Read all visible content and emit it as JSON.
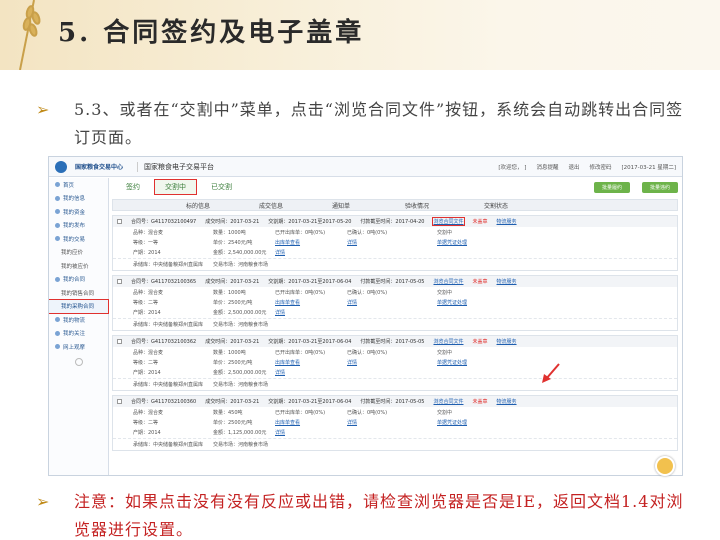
{
  "slide": {
    "title": "5. 合同签约及电子盖章",
    "bullet_symbol": "➢",
    "paragraph": "5.3、或者在“交割中”菜单，点击“浏览合同文件”按钮，系统会自动跳转出合同签订页面。",
    "note": "注意：如果点击没有没有反应或出错，请检查浏览器是否是IE，返回文档1.4对浏览器进行设置。"
  },
  "screenshot": {
    "logo_text": "国家粮食交易中心",
    "site_name": "国家粮食电子交易平台",
    "top_right": [
      "[欢迎您，        ]",
      "消息提醒",
      "退出",
      "修改密码",
      "[2017-03-21 星期二]"
    ],
    "sidebar": [
      {
        "label": "首页",
        "sub": false
      },
      {
        "label": "我的信息",
        "sub": false
      },
      {
        "label": "我的资金",
        "sub": false
      },
      {
        "label": "我的发布",
        "sub": false
      },
      {
        "label": "我的交易",
        "sub": false
      },
      {
        "label": "我的应价",
        "sub": true
      },
      {
        "label": "我的被应价",
        "sub": true
      },
      {
        "label": "我的合同",
        "sub": false
      },
      {
        "label": "我的销售合同",
        "sub": true
      },
      {
        "label": "我的采购合同",
        "sub": true,
        "active": true
      },
      {
        "label": "我的物流",
        "sub": false
      },
      {
        "label": "我的关注",
        "sub": false
      },
      {
        "label": "网上观摩",
        "sub": false
      }
    ],
    "tabs": [
      "签约",
      "交割中",
      "已交割"
    ],
    "tab_buttons": [
      "批量履约",
      "批量违约"
    ],
    "columns": [
      "标的信息",
      "成交信息",
      "通知单",
      "验收情况",
      "交割状态"
    ],
    "orders": [
      {
        "contract": "合同号：G4117032100497",
        "deal_time": "成交时间：2017-03-21",
        "delivery": "交割期：2017-03-21至2017-05-20",
        "pay_deadline": "付款截至时间：2017-04-20",
        "browse": "浏览合同文件",
        "status": "未盖章",
        "logistics": "物流服务",
        "variety": "品种：混合麦",
        "grade": "等级：一等",
        "year": "产期：2014",
        "qty": "数量：1000吨",
        "price": "单价：2540元/吨",
        "amount": "金额：2,540,000.00元",
        "out_ready": "已开出库单：0吨(0%)",
        "notice1": "出库单查看",
        "notice2": "详情",
        "accept": "已确认：0吨(0%)",
        "accept_detail": "详情",
        "state": "交割中",
        "view": "单据凭证处理",
        "repo": "承储库：中央储备粮郑州直属库",
        "market": "交易市场：河南粮食市场"
      },
      {
        "contract": "合同号：G4117032100365",
        "deal_time": "成交时间：2017-03-21",
        "delivery": "交割期：2017-03-21至2017-06-04",
        "pay_deadline": "付款截至时间：2017-05-05",
        "browse": "浏览合同文件",
        "status": "未盖章",
        "logistics": "物流服务",
        "variety": "品种：混合麦",
        "grade": "等级：二等",
        "year": "产期：2014",
        "qty": "数量：1000吨",
        "price": "单价：2500元/吨",
        "amount": "金额：2,500,000.00元",
        "out_ready": "已开出库单：0吨(0%)",
        "notice1": "出库单查看",
        "notice2": "详情",
        "accept": "已确认：0吨(0%)",
        "accept_detail": "详情",
        "state": "交割中",
        "view": "单据凭证处理",
        "repo": "承储库：中央储备粮郑州直属库",
        "market": "交易市场：河南粮食市场"
      },
      {
        "contract": "合同号：G4117032100362",
        "deal_time": "成交时间：2017-03-21",
        "delivery": "交割期：2017-03-21至2017-06-04",
        "pay_deadline": "付款截至时间：2017-05-05",
        "browse": "浏览合同文件",
        "status": "未盖章",
        "logistics": "物流服务",
        "variety": "品种：混合麦",
        "grade": "等级：二等",
        "year": "产期：2014",
        "qty": "数量：1000吨",
        "price": "单价：2500元/吨",
        "amount": "金额：2,500,000.00元",
        "out_ready": "已开出库单：0吨(0%)",
        "notice1": "出库单查看",
        "notice2": "详情",
        "accept": "已确认：0吨(0%)",
        "accept_detail": "详情",
        "state": "交割中",
        "view": "单据凭证处理",
        "repo": "承储库：中央储备粮郑州直属库",
        "market": "交易市场：河南粮食市场"
      },
      {
        "contract": "合同号：G4117032100360",
        "deal_time": "成交时间：2017-03-21",
        "delivery": "交割期：2017-03-21至2017-06-04",
        "pay_deadline": "付款截至时间：2017-05-05",
        "browse": "浏览合同文件",
        "status": "未盖章",
        "logistics": "物流服务",
        "variety": "品种：混合麦",
        "grade": "等级：二等",
        "year": "产期：2014",
        "qty": "数量：450吨",
        "price": "单价：2500元/吨",
        "amount": "金额：1,125,000.00元",
        "out_ready": "已开出库单：0吨(0%)",
        "notice1": "出库单查看",
        "notice2": "详情",
        "accept": "已确认：0吨(0%)",
        "accept_detail": "详情",
        "state": "交割中",
        "view": "单据凭证处理",
        "repo": "承储库：中央储备粮郑州直属库",
        "market": "交易市场：河南粮食市场"
      }
    ]
  },
  "colors": {
    "highlight": "#e0312f",
    "bullet": "#c08a18",
    "link": "#1f5fb0"
  }
}
